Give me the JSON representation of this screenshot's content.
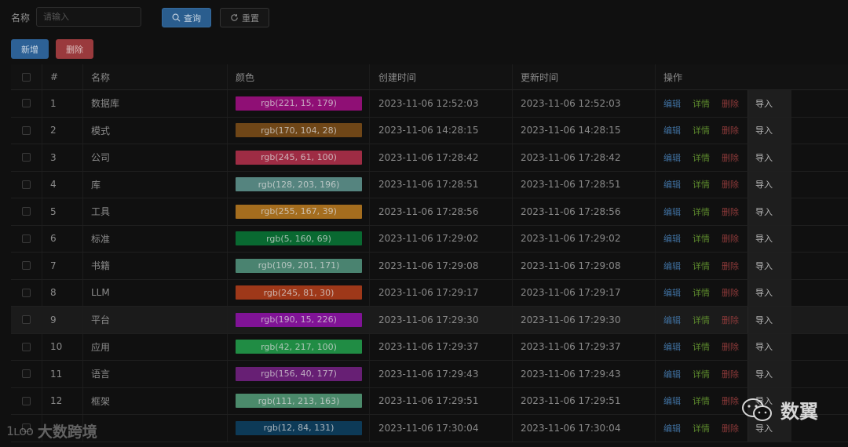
{
  "search": {
    "label": "名称",
    "placeholder": "请输入",
    "query_label": "查询",
    "reset_label": "重置"
  },
  "toolbar": {
    "add_label": "新增",
    "delete_label": "删除"
  },
  "table": {
    "headers": {
      "index": "#",
      "name": "名称",
      "color": "颜色",
      "created": "创建时间",
      "updated": "更新时间",
      "ops": "操作"
    },
    "ops": {
      "edit": "编辑",
      "detail": "详情",
      "delete": "删除",
      "import": "导入"
    },
    "rows": [
      {
        "index": "1",
        "name": "数据库",
        "color": "rgb(221, 15, 179)",
        "created": "2023-11-06 12:52:03",
        "updated": "2023-11-06 12:52:03"
      },
      {
        "index": "2",
        "name": "模式",
        "color": "rgb(170, 104, 28)",
        "created": "2023-11-06 14:28:15",
        "updated": "2023-11-06 14:28:15"
      },
      {
        "index": "3",
        "name": "公司",
        "color": "rgb(245, 61, 100)",
        "created": "2023-11-06 17:28:42",
        "updated": "2023-11-06 17:28:42"
      },
      {
        "index": "4",
        "name": "库",
        "color": "rgb(128, 203, 196)",
        "created": "2023-11-06 17:28:51",
        "updated": "2023-11-06 17:28:51"
      },
      {
        "index": "5",
        "name": "工具",
        "color": "rgb(255, 167, 39)",
        "created": "2023-11-06 17:28:56",
        "updated": "2023-11-06 17:28:56"
      },
      {
        "index": "6",
        "name": "标准",
        "color": "rgb(5, 160, 69)",
        "created": "2023-11-06 17:29:02",
        "updated": "2023-11-06 17:29:02"
      },
      {
        "index": "7",
        "name": "书籍",
        "color": "rgb(109, 201, 171)",
        "created": "2023-11-06 17:29:08",
        "updated": "2023-11-06 17:29:08"
      },
      {
        "index": "8",
        "name": "LLM",
        "color": "rgb(245, 81, 30)",
        "created": "2023-11-06 17:29:17",
        "updated": "2023-11-06 17:29:17"
      },
      {
        "index": "9",
        "name": "平台",
        "color": "rgb(190, 15, 226)",
        "created": "2023-11-06 17:29:30",
        "updated": "2023-11-06 17:29:30",
        "hover": true
      },
      {
        "index": "10",
        "name": "应用",
        "color": "rgb(42, 217, 100)",
        "created": "2023-11-06 17:29:37",
        "updated": "2023-11-06 17:29:37"
      },
      {
        "index": "11",
        "name": "语言",
        "color": "rgb(156, 40, 177)",
        "created": "2023-11-06 17:29:43",
        "updated": "2023-11-06 17:29:43"
      },
      {
        "index": "12",
        "name": "框架",
        "color": "rgb(111, 213, 163)",
        "created": "2023-11-06 17:29:51",
        "updated": "2023-11-06 17:29:51"
      },
      {
        "index": "",
        "name": "",
        "color": "rgb(12, 84, 131)",
        "created": "2023-11-06 17:30:04",
        "updated": "2023-11-06 17:30:04"
      }
    ]
  },
  "watermarks": {
    "left_logo": "1ʟᴏᴏ",
    "left_text": "大数跨境",
    "right_text": "数翼"
  }
}
